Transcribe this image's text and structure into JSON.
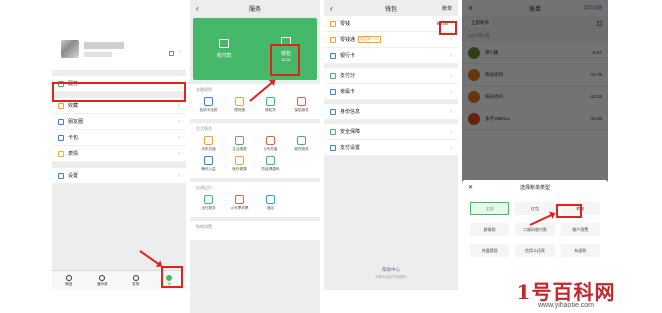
{
  "panel1": {
    "sections": [
      {
        "items": [
          {
            "icon": "service-icon",
            "label": "服务"
          }
        ]
      },
      {
        "items": [
          {
            "icon": "favorites-icon",
            "label": "收藏"
          },
          {
            "icon": "moments-icon",
            "label": "朋友圈"
          },
          {
            "icon": "cards-icon",
            "label": "卡包"
          },
          {
            "icon": "sticker-icon",
            "label": "表情"
          }
        ]
      },
      {
        "items": [
          {
            "icon": "settings-icon",
            "label": "设置"
          }
        ]
      }
    ],
    "tabbar": [
      {
        "icon": "chat-icon",
        "label": "微信"
      },
      {
        "icon": "contacts-icon",
        "label": "通讯录"
      },
      {
        "icon": "discover-icon",
        "label": "发现"
      },
      {
        "icon": "me-icon",
        "label": "我"
      }
    ]
  },
  "panel2": {
    "title": "服务",
    "green": [
      {
        "icon": "qr-pay-icon",
        "label": "收付款"
      },
      {
        "icon": "wallet-icon",
        "label": "钱包",
        "sub": "¥0.00"
      }
    ],
    "sections": [
      {
        "title": "金融理财",
        "items": [
          {
            "icon": "card-icon",
            "label": "信用卡还款",
            "color": "#3b7bd6"
          },
          {
            "icon": "wealth-icon",
            "label": "理财通"
          },
          {
            "icon": "weilidai-icon",
            "label": "微粒贷"
          },
          {
            "icon": "insurance-icon",
            "label": "保险服务"
          }
        ]
      },
      {
        "title": "生活服务",
        "items": [
          {
            "icon": "phone-icon",
            "label": "手机充值"
          },
          {
            "icon": "utilities-icon",
            "label": "生活缴费"
          },
          {
            "icon": "qcoin-icon",
            "label": "Q币充值"
          },
          {
            "icon": "city-icon",
            "label": "城市服务"
          },
          {
            "icon": "charity-icon",
            "label": "腾讯公益"
          },
          {
            "icon": "health-icon",
            "label": "医疗健康"
          },
          {
            "icon": "protection-icon",
            "label": "防疫健康码"
          }
        ]
      },
      {
        "title": "交通出行",
        "items": [
          {
            "icon": "travel-icon",
            "label": "出行服务"
          },
          {
            "icon": "train-icon",
            "label": "火车票机票"
          },
          {
            "icon": "hotel-icon",
            "label": "酒店"
          }
        ]
      },
      {
        "title": "购物消费",
        "items": []
      }
    ]
  },
  "panel3": {
    "title": "钱包",
    "bill_button": "账单",
    "items": [
      {
        "icon": "change-icon",
        "label": "零钱",
        "value": "¥0.00"
      },
      {
        "icon": "lct-icon",
        "label": "零钱通",
        "badge": "收益率2.1%",
        "value": ""
      },
      {
        "icon": "bankcard-icon",
        "label": "银行卡",
        "value": ""
      },
      {
        "icon": "paypoints-icon",
        "label": "支付分",
        "value": ""
      },
      {
        "icon": "cloud-icon",
        "label": "亲属卡",
        "value": ""
      },
      {
        "icon": "identity-icon",
        "label": "身份信息",
        "value": ""
      },
      {
        "icon": "security-icon",
        "label": "安全保障",
        "value": ""
      },
      {
        "icon": "paysettings-icon",
        "label": "支付设置",
        "value": ""
      }
    ],
    "footer_title": "帮助中心",
    "footer_sub": "本服务由财付通提供"
  },
  "panel4": {
    "title": "账单",
    "right_link": "常见问题",
    "filter": "全部账单",
    "month": "2022年6月",
    "bills": [
      {
        "icon": "merchant-icon",
        "name": "伊川路",
        "time": "",
        "amount": "-6.47",
        "color": "#6d8a3a"
      },
      {
        "icon": "merchant-icon",
        "name": "阳光达刊",
        "time": "",
        "amount": "-14.76",
        "color": "#e07a1f"
      },
      {
        "icon": "merchant-icon",
        "name": "阳光达刊",
        "time": "",
        "amount": "-12.26",
        "color": "#e07a1f"
      },
      {
        "icon": "merchant-icon",
        "name": "多点 DMALL",
        "time": "",
        "amount": "-10.00",
        "color": "#e84a1c"
      }
    ],
    "sheet_title": "选择账单类型",
    "sheet_options": [
      "全部",
      "红包",
      "转账",
      "群收款",
      "二维码收付款",
      "商户消费",
      "充值提现",
      "信用卡还款",
      "有退款"
    ]
  },
  "watermark": {
    "big": "1号百科网",
    "url": "www.yihaotie.com"
  },
  "colors": {
    "wechat_green": "#45b869",
    "red": "#e2231a"
  }
}
